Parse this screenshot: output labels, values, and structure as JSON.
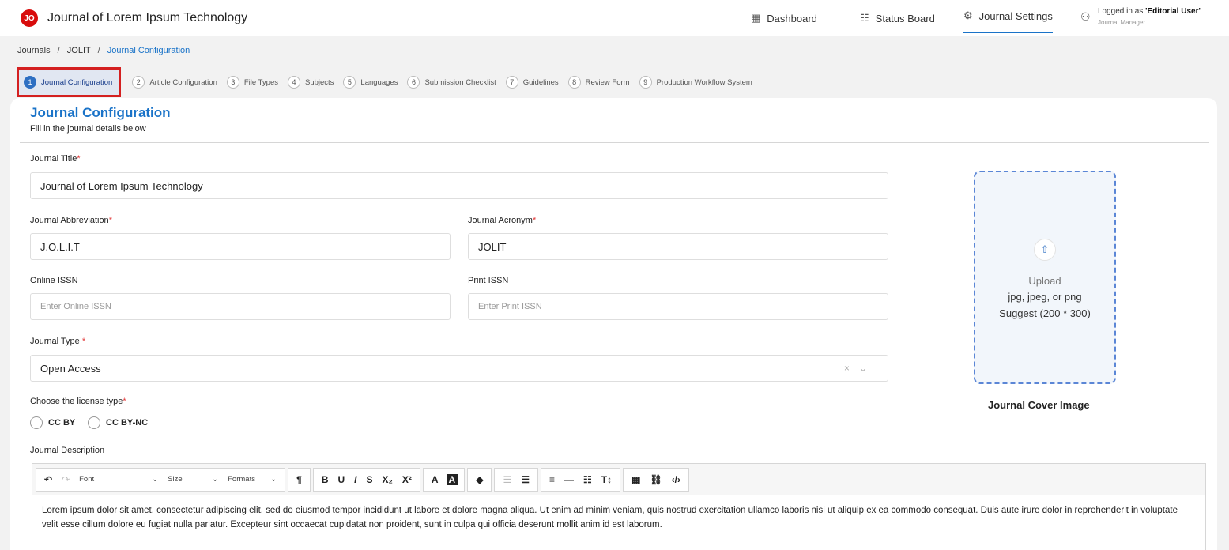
{
  "app": {
    "logo_text": "JO",
    "title": "Journal of Lorem Ipsum Technology"
  },
  "nav": {
    "dashboard": "Dashboard",
    "status_board": "Status Board",
    "journal_settings": "Journal Settings",
    "logged_in_prefix": "Logged in as ",
    "user_name": "'Editorial User'",
    "user_role": "Journal Manager"
  },
  "breadcrumb": {
    "items": [
      "Journals",
      "JOLIT",
      "Journal Configuration"
    ]
  },
  "steps": [
    {
      "num": "1",
      "label": "Journal Configuration"
    },
    {
      "num": "2",
      "label": "Article Configuration"
    },
    {
      "num": "3",
      "label": "File Types"
    },
    {
      "num": "4",
      "label": "Subjects"
    },
    {
      "num": "5",
      "label": "Languages"
    },
    {
      "num": "6",
      "label": "Submission Checklist"
    },
    {
      "num": "7",
      "label": "Guidelines"
    },
    {
      "num": "8",
      "label": "Review Form"
    },
    {
      "num": "9",
      "label": "Production Workflow System"
    }
  ],
  "form": {
    "heading": "Journal Configuration",
    "subheading": "Fill in the journal details below",
    "title_label": "Journal Title",
    "title_value": "Journal of Lorem Ipsum Technology",
    "abbr_label": "Journal Abbreviation",
    "abbr_value": "J.O.L.I.T",
    "acronym_label": "Journal Acronym",
    "acronym_value": "JOLIT",
    "online_issn_label": "Online ISSN",
    "online_issn_placeholder": "Enter Online ISSN",
    "print_issn_label": "Print ISSN",
    "print_issn_placeholder": "Enter Print ISSN",
    "type_label": "Journal Type",
    "type_value": "Open Access",
    "license_label": "Choose the license type",
    "license_options": [
      "CC BY",
      "CC BY-NC"
    ],
    "desc_label": "Journal Description",
    "required_mark": "*"
  },
  "upload": {
    "text": "Upload",
    "formats": "jpg, jpeg, or png",
    "suggest": "Suggest (200 * 300)",
    "label": "Journal Cover Image"
  },
  "editor": {
    "font": "Font",
    "size": "Size",
    "formats": "Formats",
    "content": "Lorem ipsum dolor sit amet, consectetur adipiscing elit, sed do eiusmod tempor incididunt ut labore et dolore magna aliqua. Ut enim ad minim veniam, quis nostrud exercitation ullamco laboris nisi ut aliquip ex ea commodo consequat. Duis aute irure dolor in reprehenderit in voluptate velit esse cillum dolore eu fugiat nulla pariatur. Excepteur sint occaecat cupidatat non proident, sunt in culpa qui officia deserunt mollit anim id est laborum."
  },
  "colors": {
    "accent": "#1a73c8",
    "highlight_border": "#d42020",
    "logo": "#d80c0c"
  }
}
